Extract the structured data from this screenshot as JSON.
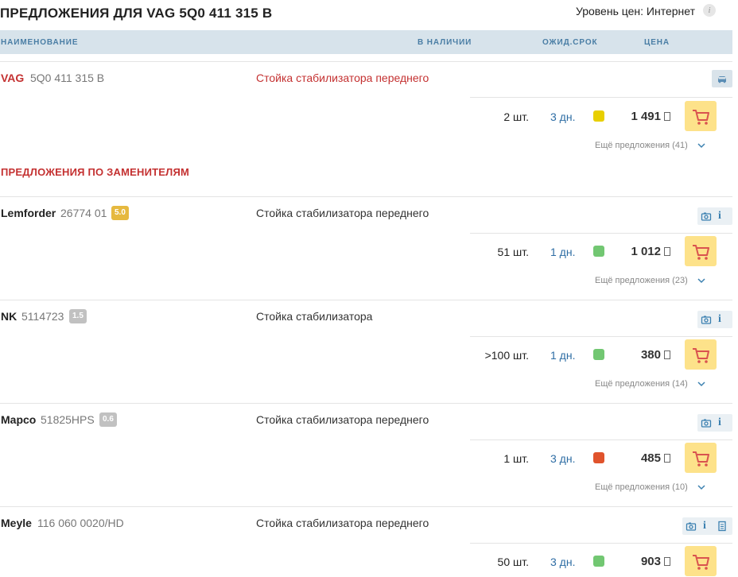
{
  "header": {
    "title": "ПРЕДЛОЖЕНИЯ ДЛЯ  VAG 5Q0 411 315 B",
    "price_level": "Уровень цен: Интернет",
    "info_icon": "info-circle-icon"
  },
  "table_head": {
    "name": "НАИМЕНОВАНИЕ",
    "stock": "В НАЛИЧИИ",
    "wait": "ОЖИД.СРОК",
    "price": "ЦЕНА"
  },
  "colors": {
    "accent_red": "#c43131",
    "header_blue": "#4a7ea5",
    "cart_yellow": "#fde28a",
    "status_yellow": "#e8cf00",
    "status_green": "#72c772",
    "status_red": "#e0532c"
  },
  "main_product": {
    "brand": "VAG",
    "article": "5Q0 411 315 B",
    "description": "Стойка стабилизатора переднего",
    "tool_icon": "car-icon",
    "offer": {
      "qty": "2 шт.",
      "days": "3 дн.",
      "status_color": "#e8cf00",
      "price": "1 491",
      "currency_icon": "ruble-icon",
      "more": "Ещё предложения (41)"
    }
  },
  "section_title": "ПРЕДЛОЖЕНИЯ ПО ЗАМЕНИТЕЛЯМ",
  "substitutes": [
    {
      "brand": "Lemforder",
      "article": "26774 01",
      "rating": "5.0",
      "description": "Стойка стабилизатора переднего",
      "offer": {
        "qty": "51 шт.",
        "days": "1 дн.",
        "status_color": "#72c772",
        "price": "1 012",
        "more": "Ещё предложения (23)"
      }
    },
    {
      "brand": "NK",
      "article": "5114723",
      "rating": "1.5",
      "description": "Стойка стабилизатора",
      "offer": {
        "qty": ">100 шт.",
        "days": "1 дн.",
        "status_color": "#72c772",
        "price": "380",
        "more": "Ещё предложения (14)"
      }
    },
    {
      "brand": "Mapco",
      "article": "51825HPS",
      "rating": "0.6",
      "description": "Стойка стабилизатора переднего",
      "offer": {
        "qty": "1 шт.",
        "days": "3 дн.",
        "status_color": "#e0532c",
        "price": "485",
        "more": "Ещё предложения (10)"
      }
    },
    {
      "brand": "Meyle",
      "article": "116 060 0020/HD",
      "description": "Стойка стабилизатора переднего",
      "offer": {
        "qty": "50 шт.",
        "days": "3 дн.",
        "status_color": "#72c772",
        "price": "903"
      }
    }
  ]
}
